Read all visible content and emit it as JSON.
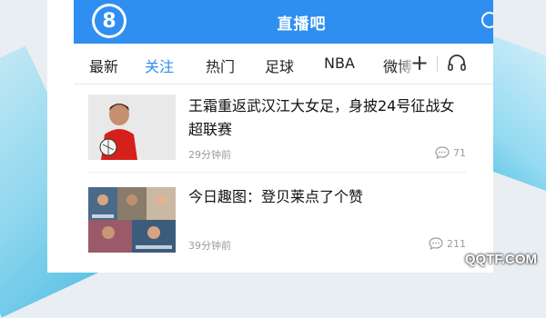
{
  "header": {
    "logo_text": "8",
    "title": "直播吧",
    "search_icon": "search-icon"
  },
  "tabs": [
    {
      "label": "最新",
      "active": false
    },
    {
      "label": "关注",
      "active": true
    },
    {
      "label": "热门",
      "active": false
    },
    {
      "label": "足球",
      "active": false
    },
    {
      "label": "NBA",
      "active": false
    },
    {
      "label": "微博",
      "active": false
    }
  ],
  "tab_actions": {
    "add_label": "+",
    "headset_icon": "headset-icon"
  },
  "news": [
    {
      "headline": "王霜重返武汉江大女足，身披24号征战女超联赛",
      "time": "29分钟前",
      "comments": "71"
    },
    {
      "headline": "今日趣图：登贝莱点了个赞",
      "time": "39分钟前",
      "comments": "211"
    }
  ],
  "watermark": "QQTF.COM",
  "colors": {
    "brand_blue": "#2f8ff0",
    "tab_active": "#2f8ff0",
    "meta_gray": "#9b9b9b"
  }
}
